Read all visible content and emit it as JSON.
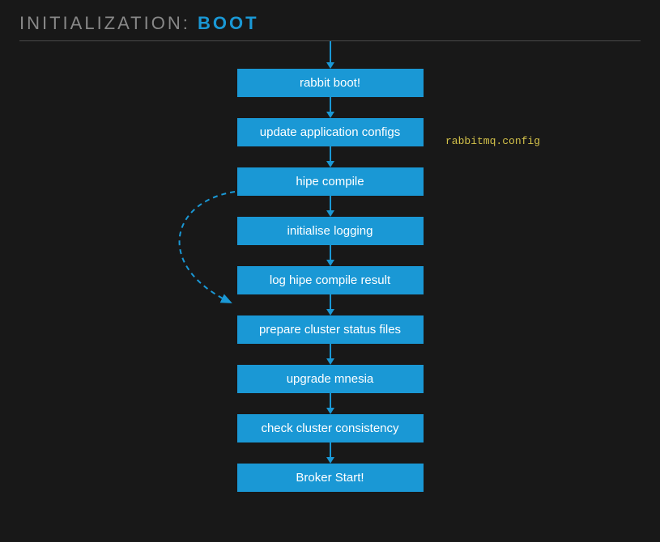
{
  "header": {
    "prefix": "INITIALIZATION:",
    "suffix": "BOOT"
  },
  "steps": [
    {
      "label": "rabbit boot!"
    },
    {
      "label": "update application configs"
    },
    {
      "label": "hipe compile"
    },
    {
      "label": "initialise logging"
    },
    {
      "label": "log hipe compile result"
    },
    {
      "label": "prepare cluster status files"
    },
    {
      "label": "upgrade mnesia"
    },
    {
      "label": "check cluster consistency"
    },
    {
      "label": "Broker Start!"
    }
  ],
  "annotation": {
    "text": "rabbitmq.config"
  },
  "colors": {
    "background": "#181818",
    "box": "#1a98d5",
    "annotation": "#d4c24a",
    "headerPrefix": "#888",
    "headerSuffix": "#1a98d5"
  },
  "curvedArrow": {
    "fromStep": 2,
    "toStep": 4,
    "description": "dashed curved arrow from hipe compile to log hipe compile result"
  }
}
